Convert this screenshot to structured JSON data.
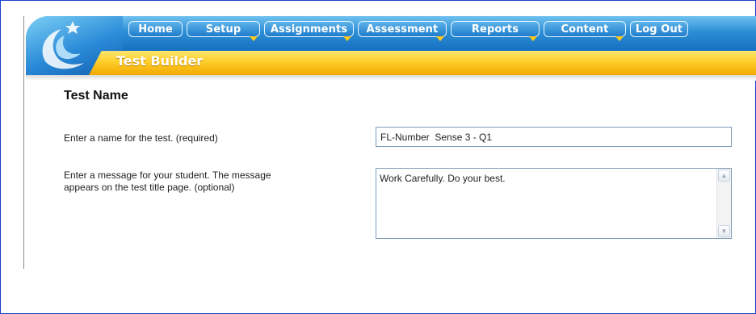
{
  "nav": {
    "items": [
      {
        "label": "Home",
        "has_menu": false
      },
      {
        "label": "Setup",
        "has_menu": true
      },
      {
        "label": "Assignments",
        "has_menu": true
      },
      {
        "label": "Assessment",
        "has_menu": true
      },
      {
        "label": "Reports",
        "has_menu": true
      },
      {
        "label": "Content",
        "has_menu": true
      },
      {
        "label": "Log Out",
        "has_menu": false
      }
    ]
  },
  "header": {
    "page_title": "Test Builder",
    "logo_icon": "star-swoosh-logo",
    "colors": {
      "blue": "#2c8ed6",
      "orange": "#ffce2a"
    }
  },
  "form": {
    "section_title": "Test Name",
    "name_label": "Enter a name for the test. (required)",
    "name_value": "FL-Number  Sense 3 - Q1",
    "message_label_line1": "Enter a message for your student. The message",
    "message_label_line2": "appears on the test title page. (optional)",
    "message_value": "Work Carefully. Do your best."
  }
}
